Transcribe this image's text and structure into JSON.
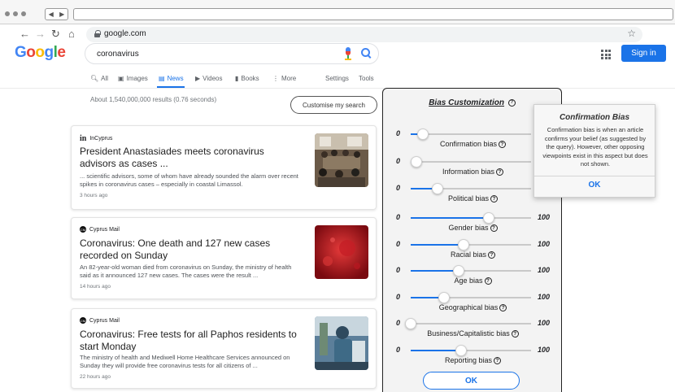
{
  "browser": {
    "url": "google.com"
  },
  "google": {
    "logo": [
      "G",
      "o",
      "o",
      "g",
      "l",
      "e"
    ],
    "query": "coronavirus",
    "sign_in": "Sign in",
    "tabs": [
      "All",
      "Images",
      "News",
      "Videos",
      "Books",
      "More",
      "Settings",
      "Tools"
    ],
    "active_tab": "News",
    "result_stats": "About 1,540,000,000 results (0.76 seconds)",
    "customise_button": "Customise my search"
  },
  "results": [
    {
      "source": "InCyprus",
      "source_logo": "in",
      "headline": "President Anastasiades meets coronavirus advisors as cases ...",
      "snippet": "... scientific advisors, some of whom have already sounded the alarm over recent spikes in coronavirus cases – especially in coastal Limassol.",
      "time": "3 hours ago"
    },
    {
      "source": "Cyprus Mail",
      "source_logo": "CM",
      "headline": "Coronavirus: One death and 127 new cases recorded on Sunday",
      "snippet": "An 82-year-old woman died from coronavirus on Sunday, the ministry of health said as it announced 127 new cases. The cases were the result ...",
      "time": "14 hours ago"
    },
    {
      "source": "Cyprus Mail",
      "source_logo": "CM",
      "headline": "Coronavirus: Free tests for all Paphos residents to start Monday",
      "snippet": "The ministry of health and Mediwell Home Healthcare Services announced on Sunday they will provide free coronavirus tests for all citizens of ...",
      "time": "22 hours ago"
    }
  ],
  "bias_panel": {
    "title": "Bias Customization",
    "help_glyph": "?",
    "ok": "OK",
    "sliders": [
      {
        "label": "Confirmation bias",
        "min": "0",
        "max": "100",
        "value": 10
      },
      {
        "label": "Information bias",
        "min": "0",
        "max": "100",
        "value": 5
      },
      {
        "label": "Political bias",
        "min": "0",
        "max": "100",
        "value": 22
      },
      {
        "label": "Gender bias",
        "min": "0",
        "max": "100",
        "value": 65
      },
      {
        "label": "Racial bias",
        "min": "0",
        "max": "100",
        "value": 44
      },
      {
        "label": "Age bias",
        "min": "0",
        "max": "100",
        "value": 40
      },
      {
        "label": "Geographical bias",
        "min": "0",
        "max": "100",
        "value": 28
      },
      {
        "label": "Business/Capitalistic bias",
        "min": "0",
        "max": "100",
        "value": 0
      },
      {
        "label": "Reporting bias",
        "min": "0",
        "max": "100",
        "value": 42
      }
    ]
  },
  "tooltip": {
    "title": "Confirmation Bias",
    "body": "Confirmation bias is when an article confirms your belief (as suggested by the query). However, other opposing viewpoints exist in this aspect but does not shown.",
    "ok": "OK"
  },
  "colors": {
    "accent": "#1a73e8",
    "panel_bg": "#f3f3f3"
  }
}
